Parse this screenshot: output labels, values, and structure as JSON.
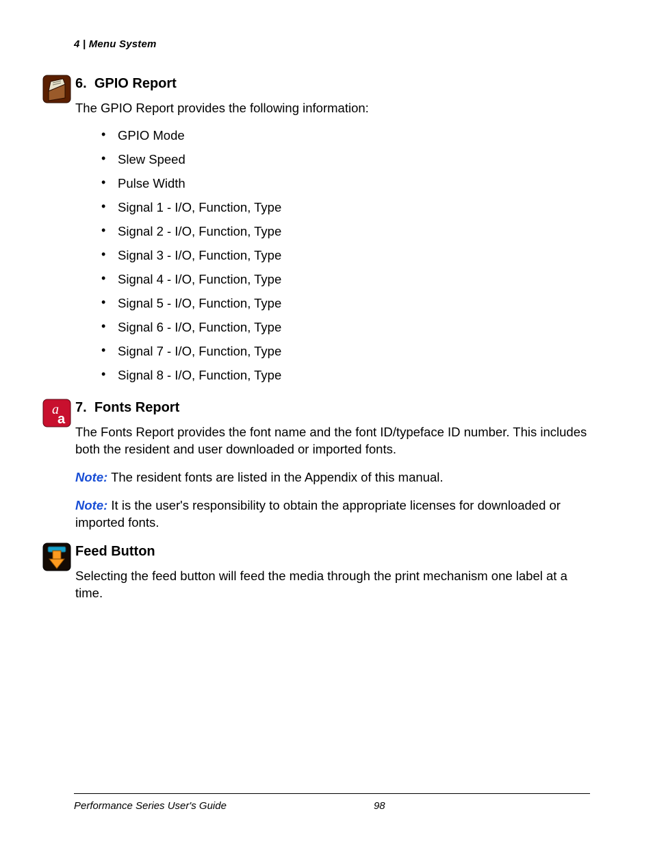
{
  "header": {
    "chapter_no": "4",
    "sep": "  |  ",
    "chapter_title": "Menu System"
  },
  "sections": {
    "gpio": {
      "number": "6.",
      "title": "GPIO Report",
      "intro": "The GPIO Report provides the following information:",
      "items": [
        "GPIO Mode",
        "Slew Speed",
        "Pulse Width",
        "Signal 1 - I/O, Function, Type",
        "Signal 2 - I/O, Function, Type",
        "Signal 3 - I/O, Function, Type",
        "Signal 4 - I/O, Function, Type",
        "Signal 5 - I/O, Function, Type",
        "Signal 6 - I/O, Function, Type",
        "Signal 7 - I/O, Function, Type",
        "Signal 8 - I/O, Function, Type"
      ]
    },
    "fonts": {
      "number": "7.",
      "title": "Fonts Report",
      "intro": "The Fonts Report provides the font name and the font ID/typeface ID number. This includes both the resident and user downloaded or imported fonts.",
      "note_label": "Note:",
      "note1": " The resident fonts are listed in the Appendix of this manual.",
      "note2": " It is the user's responsibility to obtain the appropriate licenses for downloaded or imported fonts."
    },
    "feed": {
      "title": "Feed Button",
      "intro": "Selecting the feed button will feed the media through the print mechanism one label at a time."
    }
  },
  "footer": {
    "doc_title": "Performance Series User's Guide",
    "page_no": "98"
  }
}
